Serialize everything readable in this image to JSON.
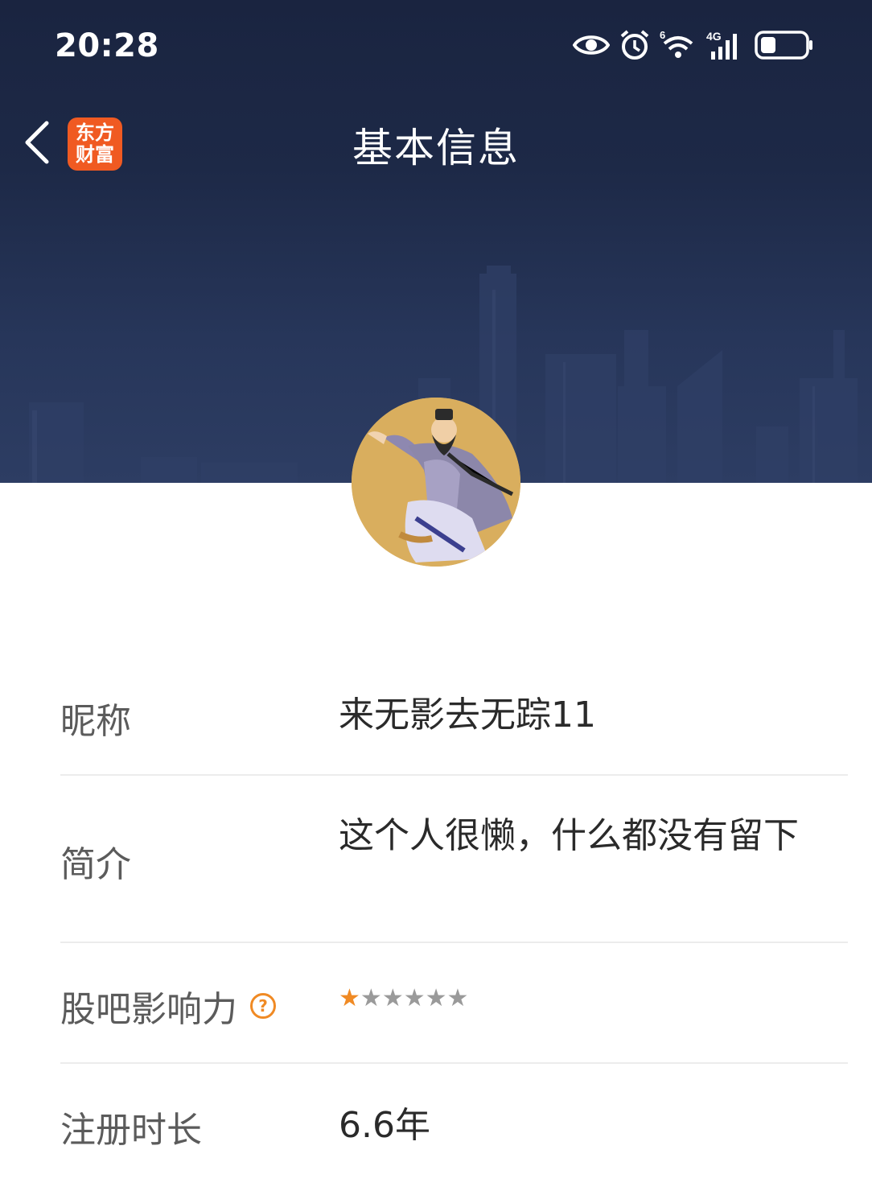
{
  "status_bar": {
    "time": "20:28",
    "icons": [
      "eye-icon",
      "alarm-icon",
      "wifi-6-icon",
      "signal-4g-icon",
      "battery-icon"
    ],
    "wifi_label": "6",
    "network_label": "4G"
  },
  "nav": {
    "back_icon": "chevron-left-icon",
    "app_logo_line1": "东方",
    "app_logo_line2": "财富",
    "title": "基本信息"
  },
  "profile": {
    "avatar": "avatar-image"
  },
  "info": {
    "nickname_label": "昵称",
    "nickname_value": "来无影去无踪11",
    "bio_label": "简介",
    "bio_value": "这个人很懒，什么都没有留下",
    "influence_label": "股吧影响力",
    "influence_help": "?",
    "influence_stars_total": 6,
    "influence_stars_filled": 1,
    "registration_label": "注册时长",
    "registration_value": "6.6年"
  },
  "colors": {
    "header_bg": "#1d2947",
    "logo_bg": "#f05a22",
    "accent_orange": "#f08a24",
    "label_text": "#5b5b5b",
    "value_text": "#2a2a2a",
    "divider": "#ececec"
  }
}
